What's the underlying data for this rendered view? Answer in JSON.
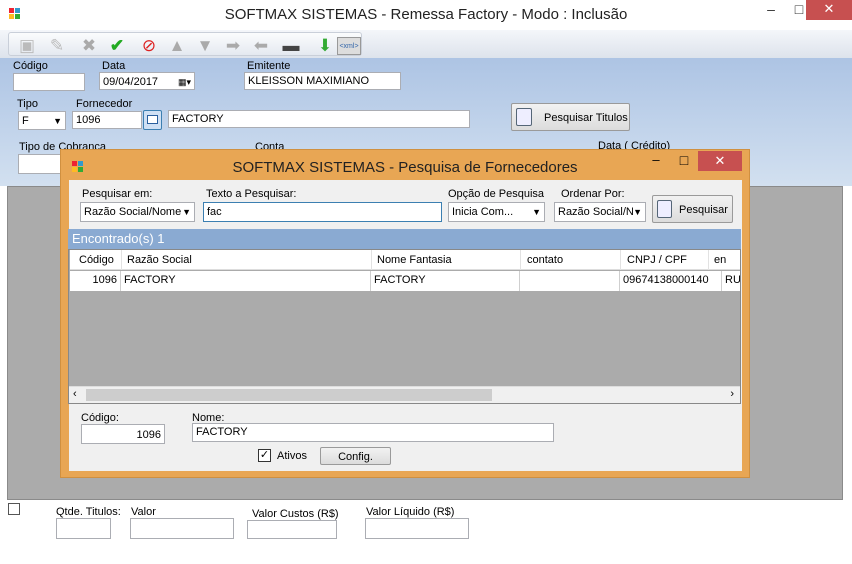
{
  "window": {
    "title": "SOFTMAX SISTEMAS - Remessa Factory  - Modo : Inclusão",
    "minimize": "–",
    "maximize": "□",
    "close": "✕"
  },
  "toolbar": {
    "icons": [
      "new-icon",
      "edit-icon",
      "delete-icon",
      "confirm-icon",
      "cancel-icon",
      "first-icon",
      "previous-icon",
      "next-icon",
      "last-icon",
      "print-icon",
      "export-icon",
      "xml-icon"
    ],
    "xml_label": "<xml>"
  },
  "form": {
    "codigo_label": "Código",
    "codigo_value": "",
    "data_label": "Data",
    "data_value": "09/04/2017",
    "emitente_label": "Emitente",
    "emitente_value": "KLEISSON MAXIMIANO",
    "tipo_label": "Tipo",
    "tipo_value": "F",
    "fornecedor_label": "Fornecedor",
    "fornecedor_code": "1096",
    "fornecedor_name": "FACTORY",
    "pesquisar_titulos_label": "Pesquisar Titulos",
    "tipo_cobranca_label": "Tipo de Cobranca",
    "conta_label": "Conta",
    "data_credito_label": "Data ( Crédito)"
  },
  "footer": {
    "qtde_titulos_label": "Qtde. Titulos:",
    "valor_label": "Valor",
    "valor_custos_label": "Valor Custos (R$)",
    "valor_liquido_label": "Valor Líquido (R$)"
  },
  "dialog": {
    "title": "SOFTMAX SISTEMAS - Pesquisa de Fornecedores",
    "minimize": "–",
    "maximize": "□",
    "close": "✕",
    "pesquisar_em_label": "Pesquisar em:",
    "pesquisar_em_value": "Razão Social/Nome",
    "texto_label": "Texto a Pesquisar:",
    "texto_value": "fac",
    "opcao_label": "Opção de Pesquisa",
    "opcao_value": "Inicia Com...",
    "ordenar_label": "Ordenar Por:",
    "ordenar_value": "Razão Social/N",
    "pesquisar_button": "Pesquisar",
    "found_label": "Encontrado(s) 1",
    "grid": {
      "headers": [
        "Código",
        "Razão Social",
        "Nome Fantasia",
        "contato",
        "CNPJ / CPF",
        "en"
      ],
      "rows": [
        [
          "1096",
          "FACTORY",
          "FACTORY",
          "",
          "09674138000140",
          "RU/"
        ]
      ]
    },
    "codigo_label": "Código:",
    "codigo_value": "1096",
    "nome_label": "Nome:",
    "nome_value": "FACTORY",
    "ativos_label": "Ativos",
    "ativos_checked": true,
    "config_button": "Config."
  }
}
